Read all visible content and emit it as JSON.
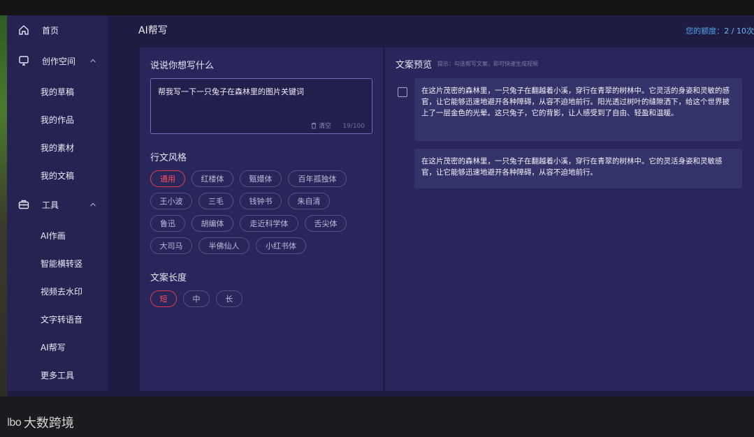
{
  "sidebar": {
    "home": "首页",
    "creation_space": "创作空间",
    "creation_items": [
      "我的草稿",
      "我的作品",
      "我的素材",
      "我的文稿"
    ],
    "tools": "工具",
    "tool_items": [
      "AI作画",
      "智能横转竖",
      "视频去水印",
      "文字转语音",
      "AI帮写",
      "更多工具"
    ]
  },
  "header": {
    "title": "AI帮写",
    "quota_label": "您的额度：",
    "quota_value": "2 / 10次"
  },
  "left_panel": {
    "prompt_title": "说说你想写什么",
    "prompt_value": "帮我写一下一只兔子在森林里的图片关键词",
    "clear_label": "清空",
    "char_count": "19/100",
    "style_title": "行文风格",
    "styles": [
      "通用",
      "红楼体",
      "甄嬛体",
      "百年孤独体",
      "王小波",
      "三毛",
      "钱钟书",
      "朱自清",
      "鲁迅",
      "胡编体",
      "走近科学体",
      "舌尖体",
      "大司马",
      "半佛仙人",
      "小红书体"
    ],
    "style_selected": "通用",
    "length_title": "文案长度",
    "lengths": [
      "短",
      "中",
      "长"
    ],
    "length_selected": "短"
  },
  "right_panel": {
    "title": "文案预览",
    "hint": "提示：勾选帮写文案，即可快速生成视频",
    "results": [
      "在这片茂密的森林里，一只兔子在翻越着小溪，穿行在青翠的树林中。它灵活的身姿和灵敏的感官，让它能够迅速地避开各种障碍，从容不迫地前行。阳光透过树叶的缝隙洒下，给这个世界披上了一层金色的光晕。这只兔子，它的背影，让人感受到了自由、轻盈和温暖。",
      "在这片茂密的森林里，一只兔子在翻越着小溪，穿行在青翠的树林中。它的灵活身姿和灵敏感官，让它能够迅速地避开各种障碍，从容不迫地前行。"
    ]
  },
  "watermark": {
    "logo": "lbo",
    "text": "大数跨境"
  },
  "colors": {
    "accent_red": "#e0394f",
    "quota_blue": "#4fa3e8",
    "panel": "#28265a",
    "sidebar": "#252352"
  }
}
